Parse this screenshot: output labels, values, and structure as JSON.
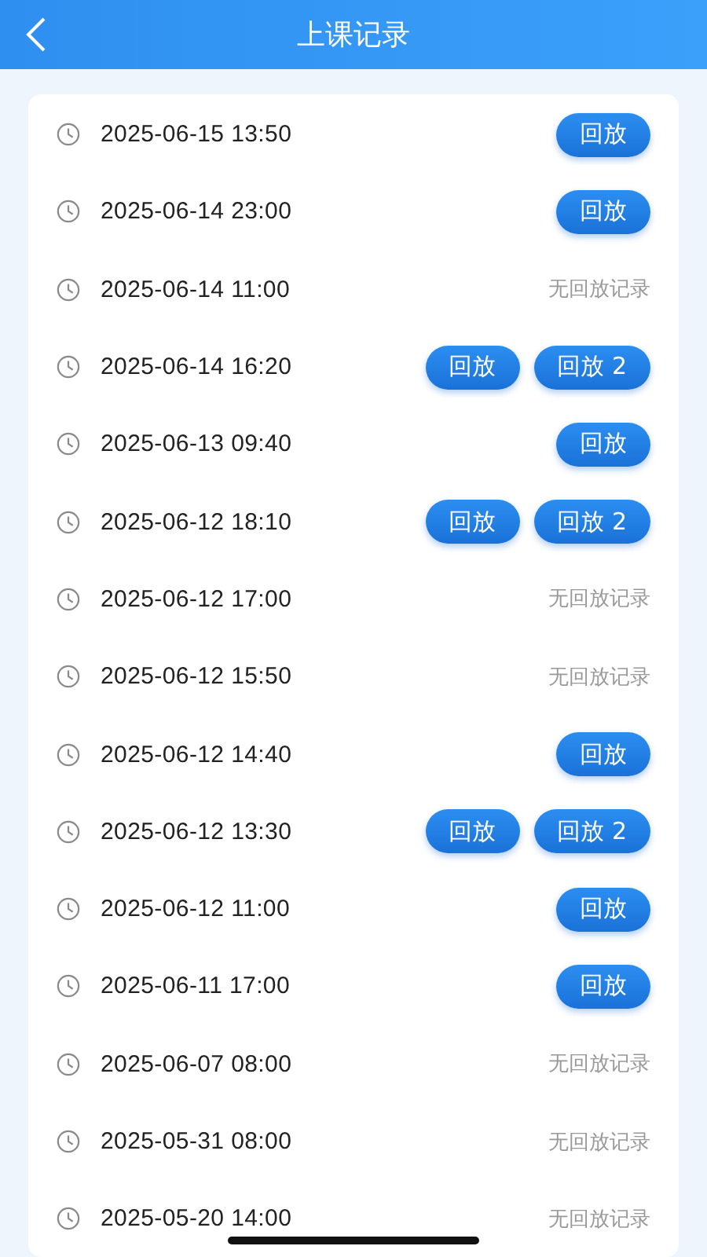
{
  "header": {
    "title": "上课记录"
  },
  "records": [
    {
      "time": "2025-06-15 13:50",
      "kind": "replay",
      "buttons": [
        "回放"
      ]
    },
    {
      "time": "2025-06-14 23:00",
      "kind": "replay",
      "buttons": [
        "回放"
      ]
    },
    {
      "time": "2025-06-14 11:00",
      "kind": "none",
      "note": "无回放记录"
    },
    {
      "time": "2025-06-14 16:20",
      "kind": "replay",
      "buttons": [
        "回放",
        "回放 2"
      ]
    },
    {
      "time": "2025-06-13 09:40",
      "kind": "replay",
      "buttons": [
        "回放"
      ]
    },
    {
      "time": "2025-06-12 18:10",
      "kind": "replay",
      "buttons": [
        "回放",
        "回放 2"
      ]
    },
    {
      "time": "2025-06-12 17:00",
      "kind": "none",
      "note": "无回放记录"
    },
    {
      "time": "2025-06-12 15:50",
      "kind": "none",
      "note": "无回放记录"
    },
    {
      "time": "2025-06-12 14:40",
      "kind": "replay",
      "buttons": [
        "回放"
      ]
    },
    {
      "time": "2025-06-12 13:30",
      "kind": "replay",
      "buttons": [
        "回放",
        "回放 2"
      ]
    },
    {
      "time": "2025-06-12 11:00",
      "kind": "replay",
      "buttons": [
        "回放"
      ]
    },
    {
      "time": "2025-06-11 17:00",
      "kind": "replay",
      "buttons": [
        "回放"
      ]
    },
    {
      "time": "2025-06-07 08:00",
      "kind": "none",
      "note": "无回放记录"
    },
    {
      "time": "2025-05-31 08:00",
      "kind": "none",
      "note": "无回放记录"
    },
    {
      "time": "2025-05-20 14:00",
      "kind": "none",
      "note": "无回放记录"
    }
  ]
}
